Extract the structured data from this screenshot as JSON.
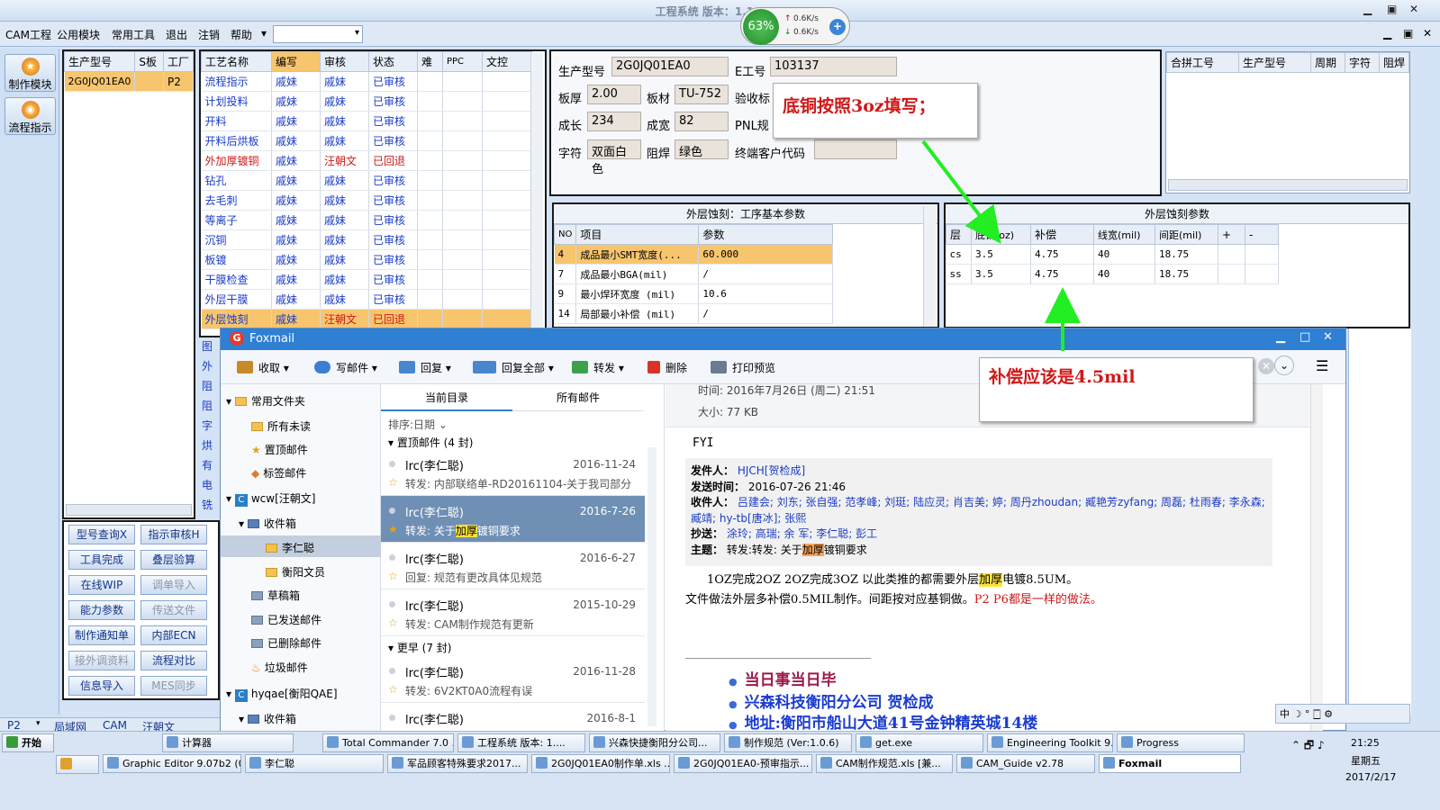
{
  "app": {
    "title": "工程系统   版本：1.1.51.0",
    "menus": [
      "CAM工程",
      "公用模块",
      "常用工具",
      "退出",
      "注销",
      "帮助"
    ],
    "perf": {
      "percent": "63%",
      "up": "0.6K/s",
      "down": "0.6K/s"
    }
  },
  "leftnav": {
    "make": "制作模块",
    "flow": "流程指示"
  },
  "products": {
    "headers": [
      "生产型号",
      "S板",
      "工厂"
    ],
    "rows": [
      [
        "2G0JQ01EA0",
        "",
        "P2"
      ]
    ]
  },
  "process": {
    "headers": [
      "工艺名称",
      "编写",
      "审核",
      "状态",
      "难",
      "PPC",
      "文控"
    ],
    "rows": [
      [
        "流程指示",
        "戚妹",
        "戚妹",
        "已审核"
      ],
      [
        "计划投料",
        "戚妹",
        "戚妹",
        "已审核"
      ],
      [
        "开料",
        "戚妹",
        "戚妹",
        "已审核"
      ],
      [
        "开料后烘板",
        "戚妹",
        "戚妹",
        "已审核"
      ],
      [
        "外加厚镀铜",
        "戚妹",
        "汪朝文",
        "已回退"
      ],
      [
        "钻孔",
        "戚妹",
        "戚妹",
        "已审核"
      ],
      [
        "去毛刺",
        "戚妹",
        "戚妹",
        "已审核"
      ],
      [
        "等离子",
        "戚妹",
        "戚妹",
        "已审核"
      ],
      [
        "沉铜",
        "戚妹",
        "戚妹",
        "已审核"
      ],
      [
        "板镀",
        "戚妹",
        "戚妹",
        "已审核"
      ],
      [
        "干膜检查",
        "戚妹",
        "戚妹",
        "已审核"
      ],
      [
        "外层干膜",
        "戚妹",
        "戚妹",
        "已审核"
      ],
      [
        "外层蚀刻",
        "戚妹",
        "汪朝文",
        "已回退"
      ]
    ],
    "hidden_rows": [
      "图",
      "外",
      "阻",
      "阻",
      "字",
      "烘",
      "有",
      "电",
      "铣"
    ]
  },
  "tools": [
    [
      "型号查询X",
      "指示审核H"
    ],
    [
      "工具完成",
      "叠层验算"
    ],
    [
      "在线WIP",
      "调单导入"
    ],
    [
      "能力参数",
      "传送文件"
    ],
    [
      "制作通知单",
      "内部ECN"
    ],
    [
      "接外调资料",
      "流程对比"
    ],
    [
      "信息导入",
      "MES同步"
    ]
  ],
  "statusbar": [
    "P2",
    "局域网",
    "CAM",
    "汪朝文"
  ],
  "info": {
    "model_label": "生产型号",
    "model": "2G0JQ01EA0",
    "e_label": "E工号",
    "e": "103137",
    "thick_label": "板厚",
    "thick": "2.00",
    "mat_label": "板材",
    "mat": "TU-752",
    "verify_label": "验收标",
    "len_label": "成长",
    "len": "234",
    "wid_label": "成宽",
    "wid": "82",
    "pnl_label": "PNL规",
    "char_label": "字符",
    "char": "双面白色",
    "mask_label": "阻焊",
    "mask": "绿色",
    "cust_label": "终端客户代码"
  },
  "merge": {
    "headers": [
      "合拼工号",
      "生产型号",
      "周期",
      "字符",
      "阻焊"
    ]
  },
  "etch_basic": {
    "title": "外层蚀刻：工序基本参数",
    "headers": [
      "NO",
      "项目",
      "参数"
    ],
    "rows": [
      [
        "4",
        "成品最小SMT宽度(...",
        "60.000"
      ],
      [
        "7",
        "成品最小BGA(mil)",
        "/"
      ],
      [
        "9",
        "最小焊环宽度 (mil)",
        "10.6"
      ],
      [
        "14",
        "局部最小补偿 (mil)",
        "/"
      ]
    ]
  },
  "etch_param": {
    "title": "外层蚀刻参数",
    "headers": [
      "层",
      "底铜(oz)",
      "补偿",
      "线宽(mil)",
      "间距(mil)",
      "+",
      "-"
    ],
    "rows": [
      [
        "cs",
        "3.5",
        "4.75",
        "40",
        "18.75"
      ],
      [
        "ss",
        "3.5",
        "4.75",
        "40",
        "18.75"
      ]
    ]
  },
  "callouts": {
    "copper": "底铜按照3oz填写；",
    "comp": "补偿应该是4.5mil"
  },
  "foxmail": {
    "title": "Foxmail",
    "toolbar": [
      "收取",
      "写邮件",
      "回复",
      "回复全部",
      "转发",
      "删除",
      "打印预览"
    ],
    "folders": [
      "常用文件夹",
      "所有未读",
      "置顶邮件",
      "标签邮件",
      "wcw[汪朝文]",
      "收件箱",
      "李仁聪",
      "衡阳文员",
      "草稿箱",
      "已发送邮件",
      "已删除邮件",
      "垃圾邮件",
      "hyqae[衡阳QAE]",
      "收件箱"
    ],
    "tabs": [
      "当前目录",
      "所有邮件"
    ],
    "sort": "排序:日期",
    "group1": "置顶邮件 (4 封)",
    "group2": "更早 (7 封)",
    "mails": [
      {
        "from": "lrc(李仁聪)",
        "date": "2016-11-24",
        "sub": "转发: 内部联络单-RD20161104-关于我司部分"
      },
      {
        "from": "lrc(李仁聪)",
        "date": "2016-7-26",
        "sub_a": "转发: 关于",
        "sub_hl": "加厚",
        "sub_b": "镀铜要求"
      },
      {
        "from": "lrc(李仁聪)",
        "date": "2016-6-27",
        "sub": "回复: 规范有更改具体见规范"
      },
      {
        "from": "lrc(李仁聪)",
        "date": "2015-10-29",
        "sub": "转发: CAM制作规范有更新"
      },
      {
        "from": "lrc(李仁聪)",
        "date": "2016-11-28",
        "sub": "转发: 6V2KT0A0流程有误"
      },
      {
        "from": "lrc(李仁聪)",
        "date": "2016-8-1",
        "sub": ""
      }
    ],
    "reader": {
      "time_line": "时间: 2016年7月26日 (周二) 21:51",
      "size": "大小: 77 KB",
      "fyi": "FYI",
      "from_label": "发件人：",
      "from": "HJCH[贺检成]",
      "sent_label": "发送时间：",
      "sent": "2016-07-26 21:46",
      "to_label": "收件人：",
      "to": "吕建会; 刘东; 张自强; 范孝峰; 刘珽; 陆应灵; 肖吉美; 婷; 周丹zhoudan; 臧艳芳zyfang; 周磊; 杜雨春; 李永森; 臧靖; hy-tb[唐冰]; 张熙",
      "cc_label": "抄送：",
      "cc": "涂玲; 高瑞; 余 军; 李仁聪; 彭工",
      "subj_label": "主题：",
      "subj_a": "转发:转发: 关于",
      "subj_hl": "加厚",
      "subj_b": "镀铜要求",
      "body1_a": "1OZ完成2OZ 2OZ完成3OZ 以此类推的都需要外层",
      "body1_hl": "加厚",
      "body1_b": "电镀8.5UM。",
      "body2_a": "文件做法外层多补偿0.5MIL制作。间距按对应基铜做。",
      "body2_b": "P2 P6都是一样的做法。",
      "sig1": "当日事当日毕",
      "sig2": "兴森科技衡阳分公司   贺检成",
      "sig3": "地址:衡阳市船山大道41号金钟精英城14楼"
    }
  },
  "taskbar": {
    "start": "开始",
    "row1": [
      "计算器",
      "Total Commander 7.0 ...",
      "工程系统  版本: 1....",
      "兴森快捷衡阳分公司...",
      "制作规范 (Ver:1.0.6)",
      "get.exe",
      "Engineering Toolkit 9....",
      "Progress"
    ],
    "row2": [
      "Graphic Editor 9.07b2 (0...",
      "李仁聪",
      "军品顾客特殊要求2017...",
      "2G0JQ01EA0制作单.xls ...",
      "2G0JQ01EA0-预审指示...",
      "CAM制作规范.xls [兼...",
      "CAM_Guide v2.78",
      "Foxmail"
    ],
    "time": "21:25",
    "weekday": "星期五",
    "date": "2017/2/17"
  },
  "colors": {
    "accent": "#2f7fd3",
    "callout_red": "#d01818",
    "arrow": "#22ee22",
    "highlight": "#f7c56e"
  }
}
